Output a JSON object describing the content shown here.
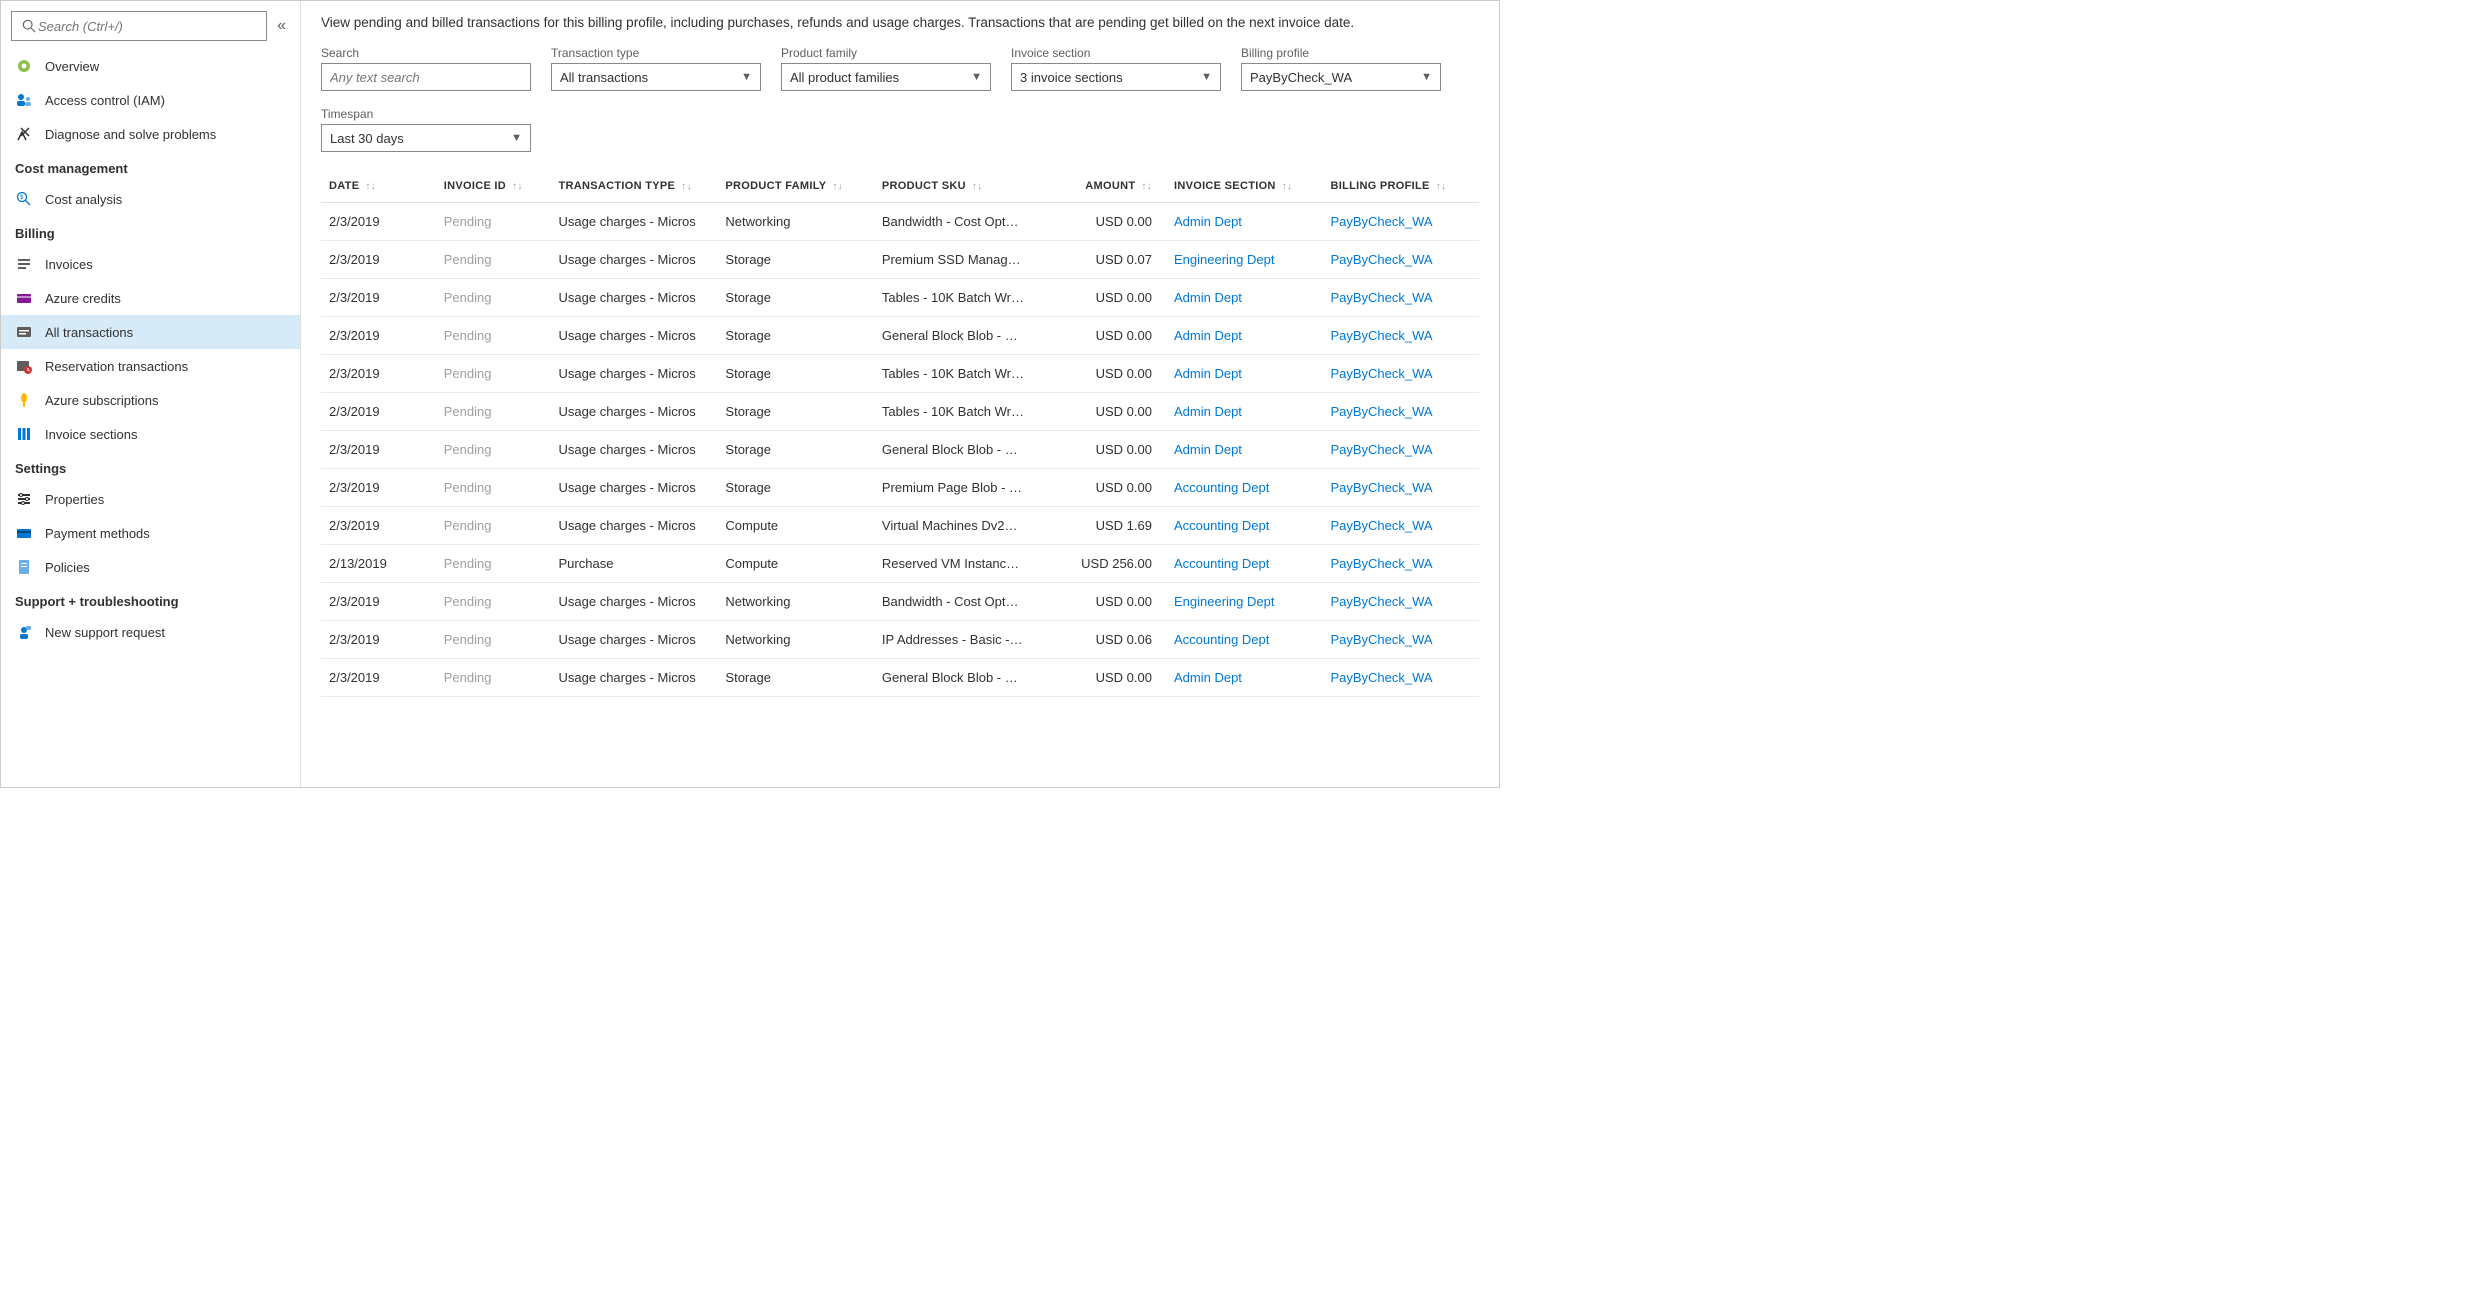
{
  "sidebar": {
    "search_placeholder": "Search (Ctrl+/)",
    "items_top": [
      {
        "icon": "overview",
        "label": "Overview"
      },
      {
        "icon": "iam",
        "label": "Access control (IAM)"
      },
      {
        "icon": "diagnose",
        "label": "Diagnose and solve problems"
      }
    ],
    "groups": [
      {
        "title": "Cost management",
        "items": [
          {
            "icon": "cost",
            "label": "Cost analysis"
          }
        ]
      },
      {
        "title": "Billing",
        "items": [
          {
            "icon": "invoices",
            "label": "Invoices"
          },
          {
            "icon": "credits",
            "label": "Azure credits"
          },
          {
            "icon": "transactions",
            "label": "All transactions",
            "active": true
          },
          {
            "icon": "reservation",
            "label": "Reservation transactions"
          },
          {
            "icon": "subs",
            "label": "Azure subscriptions"
          },
          {
            "icon": "sections",
            "label": "Invoice sections"
          }
        ]
      },
      {
        "title": "Settings",
        "items": [
          {
            "icon": "props",
            "label": "Properties"
          },
          {
            "icon": "payment",
            "label": "Payment methods"
          },
          {
            "icon": "policies",
            "label": "Policies"
          }
        ]
      },
      {
        "title": "Support + troubleshooting",
        "items": [
          {
            "icon": "support",
            "label": "New support request"
          }
        ]
      }
    ]
  },
  "main": {
    "description": "View pending and billed transactions for this billing profile, including purchases, refunds and usage charges. Transactions that are pending get billed on the next invoice date.",
    "filters": {
      "search": {
        "label": "Search",
        "placeholder": "Any text search"
      },
      "transaction_type": {
        "label": "Transaction type",
        "value": "All transactions"
      },
      "product_family": {
        "label": "Product family",
        "value": "All product families"
      },
      "invoice_section": {
        "label": "Invoice section",
        "value": "3 invoice sections"
      },
      "billing_profile": {
        "label": "Billing profile",
        "value": "PayByCheck_WA"
      },
      "timespan": {
        "label": "Timespan",
        "value": "Last 30 days"
      }
    },
    "columns": [
      "DATE",
      "INVOICE ID",
      "TRANSACTION TYPE",
      "PRODUCT FAMILY",
      "PRODUCT SKU",
      "AMOUNT",
      "INVOICE SECTION",
      "BILLING PROFILE"
    ],
    "rows": [
      {
        "date": "2/3/2019",
        "invoice": "Pending",
        "ttype": "Usage charges - Micros",
        "pfam": "Networking",
        "sku": "Bandwidth - Cost Opt…",
        "amount": "USD 0.00",
        "section": "Admin Dept",
        "profile": "PayByCheck_WA"
      },
      {
        "date": "2/3/2019",
        "invoice": "Pending",
        "ttype": "Usage charges - Micros",
        "pfam": "Storage",
        "sku": "Premium SSD Manag…",
        "amount": "USD 0.07",
        "section": "Engineering Dept",
        "profile": "PayByCheck_WA"
      },
      {
        "date": "2/3/2019",
        "invoice": "Pending",
        "ttype": "Usage charges - Micros",
        "pfam": "Storage",
        "sku": "Tables - 10K Batch Wr…",
        "amount": "USD 0.00",
        "section": "Admin Dept",
        "profile": "PayByCheck_WA"
      },
      {
        "date": "2/3/2019",
        "invoice": "Pending",
        "ttype": "Usage charges - Micros",
        "pfam": "Storage",
        "sku": "General Block Blob - …",
        "amount": "USD 0.00",
        "section": "Admin Dept",
        "profile": "PayByCheck_WA"
      },
      {
        "date": "2/3/2019",
        "invoice": "Pending",
        "ttype": "Usage charges - Micros",
        "pfam": "Storage",
        "sku": "Tables - 10K Batch Wr…",
        "amount": "USD 0.00",
        "section": "Admin Dept",
        "profile": "PayByCheck_WA"
      },
      {
        "date": "2/3/2019",
        "invoice": "Pending",
        "ttype": "Usage charges - Micros",
        "pfam": "Storage",
        "sku": "Tables - 10K Batch Wr…",
        "amount": "USD 0.00",
        "section": "Admin Dept",
        "profile": "PayByCheck_WA"
      },
      {
        "date": "2/3/2019",
        "invoice": "Pending",
        "ttype": "Usage charges - Micros",
        "pfam": "Storage",
        "sku": "General Block Blob - …",
        "amount": "USD 0.00",
        "section": "Admin Dept",
        "profile": "PayByCheck_WA"
      },
      {
        "date": "2/3/2019",
        "invoice": "Pending",
        "ttype": "Usage charges - Micros",
        "pfam": "Storage",
        "sku": "Premium Page Blob - …",
        "amount": "USD 0.00",
        "section": "Accounting Dept",
        "profile": "PayByCheck_WA"
      },
      {
        "date": "2/3/2019",
        "invoice": "Pending",
        "ttype": "Usage charges - Micros",
        "pfam": "Compute",
        "sku": "Virtual Machines Dv2…",
        "amount": "USD 1.69",
        "section": "Accounting Dept",
        "profile": "PayByCheck_WA"
      },
      {
        "date": "2/13/2019",
        "invoice": "Pending",
        "ttype": "Purchase",
        "pfam": "Compute",
        "sku": "Reserved VM Instanc…",
        "amount": "USD 256.00",
        "section": "Accounting Dept",
        "profile": "PayByCheck_WA"
      },
      {
        "date": "2/3/2019",
        "invoice": "Pending",
        "ttype": "Usage charges - Micros",
        "pfam": "Networking",
        "sku": "Bandwidth - Cost Opt…",
        "amount": "USD 0.00",
        "section": "Engineering Dept",
        "profile": "PayByCheck_WA"
      },
      {
        "date": "2/3/2019",
        "invoice": "Pending",
        "ttype": "Usage charges - Micros",
        "pfam": "Networking",
        "sku": "IP Addresses - Basic -…",
        "amount": "USD 0.06",
        "section": "Accounting Dept",
        "profile": "PayByCheck_WA"
      },
      {
        "date": "2/3/2019",
        "invoice": "Pending",
        "ttype": "Usage charges - Micros",
        "pfam": "Storage",
        "sku": "General Block Blob - …",
        "amount": "USD 0.00",
        "section": "Admin Dept",
        "profile": "PayByCheck_WA"
      }
    ]
  }
}
